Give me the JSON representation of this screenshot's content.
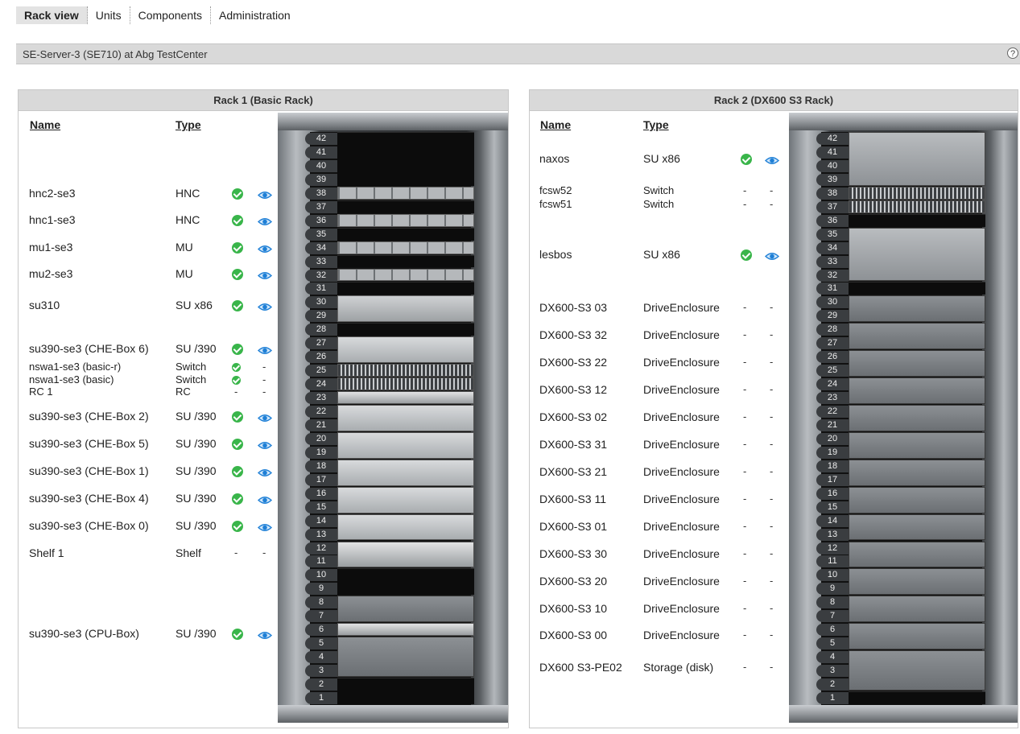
{
  "tabs": [
    {
      "label": "Rack view",
      "active": true
    },
    {
      "label": "Units",
      "active": false
    },
    {
      "label": "Components",
      "active": false
    },
    {
      "label": "Administration",
      "active": false
    }
  ],
  "header": {
    "title": "SE-Server-3 (SE710) at Abg TestCenter",
    "help": "?"
  },
  "columns": {
    "name": "Name",
    "type": "Type"
  },
  "rack1": {
    "title": "Rack 1 (Basic Rack)",
    "units": [
      "42",
      "41",
      "40",
      "39",
      "38",
      "37",
      "36",
      "35",
      "34",
      "33",
      "32",
      "31",
      "30",
      "29",
      "28",
      "27",
      "26",
      "25",
      "24",
      "23",
      "22",
      "21",
      "20",
      "19",
      "18",
      "17",
      "16",
      "15",
      "14",
      "13",
      "12",
      "11",
      "10",
      "9",
      "8",
      "7",
      "6",
      "5",
      "4",
      "3",
      "2",
      "1"
    ],
    "rows": [
      {
        "name": "hnc2-se3",
        "type": "HNC",
        "status": "ok",
        "view": true
      },
      {
        "name": "hnc1-se3",
        "type": "HNC",
        "status": "ok",
        "view": true
      },
      {
        "name": "mu1-se3",
        "type": "MU",
        "status": "ok",
        "view": true
      },
      {
        "name": "mu2-se3",
        "type": "MU",
        "status": "ok",
        "view": true
      },
      {
        "name": "su310",
        "type": "SU x86",
        "status": "ok",
        "view": true
      },
      {
        "name": "su390-se3 (CHE-Box 6)",
        "type": "SU /390",
        "status": "ok",
        "view": true
      },
      {
        "name": "nswa1-se3 (basic-r)",
        "type": "Switch",
        "status": "ok",
        "view": false,
        "dash": "-"
      },
      {
        "name": "nswa1-se3 (basic)",
        "type": "Switch",
        "status": "ok",
        "view": false,
        "dash": "-"
      },
      {
        "name": "RC 1",
        "type": "RC",
        "status": "-",
        "view": false,
        "dash": "-"
      },
      {
        "name": "su390-se3 (CHE-Box 2)",
        "type": "SU /390",
        "status": "ok",
        "view": true
      },
      {
        "name": "su390-se3 (CHE-Box 5)",
        "type": "SU /390",
        "status": "ok",
        "view": true
      },
      {
        "name": "su390-se3 (CHE-Box 1)",
        "type": "SU /390",
        "status": "ok",
        "view": true
      },
      {
        "name": "su390-se3 (CHE-Box 4)",
        "type": "SU /390",
        "status": "ok",
        "view": true
      },
      {
        "name": "su390-se3 (CHE-Box 0)",
        "type": "SU /390",
        "status": "ok",
        "view": true
      },
      {
        "name": "Shelf 1",
        "type": "Shelf",
        "status": "-",
        "view": false,
        "dash": "-"
      },
      {
        "name": "su390-se3 (CPU-Box)",
        "type": "SU /390",
        "status": "ok",
        "view": true
      }
    ]
  },
  "rack2": {
    "title": "Rack 2 (DX600 S3 Rack)",
    "units": [
      "42",
      "41",
      "40",
      "39",
      "38",
      "37",
      "36",
      "35",
      "34",
      "33",
      "32",
      "31",
      "30",
      "29",
      "28",
      "27",
      "26",
      "25",
      "24",
      "23",
      "22",
      "21",
      "20",
      "19",
      "18",
      "17",
      "16",
      "15",
      "14",
      "13",
      "12",
      "11",
      "10",
      "9",
      "8",
      "7",
      "6",
      "5",
      "4",
      "3",
      "2",
      "1"
    ],
    "rows": [
      {
        "name": "naxos",
        "type": "SU x86",
        "status": "ok",
        "view": true
      },
      {
        "name": "fcsw52",
        "type": "Switch",
        "status": "-",
        "view": false,
        "dash": "-"
      },
      {
        "name": "fcsw51",
        "type": "Switch",
        "status": "-",
        "view": false,
        "dash": "-"
      },
      {
        "name": "lesbos",
        "type": "SU x86",
        "status": "ok",
        "view": true
      },
      {
        "name": "DX600-S3 03",
        "type": "DriveEnclosure",
        "status": "-",
        "view": false,
        "dash": "-"
      },
      {
        "name": "DX600-S3 32",
        "type": "DriveEnclosure",
        "status": "-",
        "view": false,
        "dash": "-"
      },
      {
        "name": "DX600-S3 22",
        "type": "DriveEnclosure",
        "status": "-",
        "view": false,
        "dash": "-"
      },
      {
        "name": "DX600-S3 12",
        "type": "DriveEnclosure",
        "status": "-",
        "view": false,
        "dash": "-"
      },
      {
        "name": "DX600-S3 02",
        "type": "DriveEnclosure",
        "status": "-",
        "view": false,
        "dash": "-"
      },
      {
        "name": "DX600-S3 31",
        "type": "DriveEnclosure",
        "status": "-",
        "view": false,
        "dash": "-"
      },
      {
        "name": "DX600-S3 21",
        "type": "DriveEnclosure",
        "status": "-",
        "view": false,
        "dash": "-"
      },
      {
        "name": "DX600-S3 11",
        "type": "DriveEnclosure",
        "status": "-",
        "view": false,
        "dash": "-"
      },
      {
        "name": "DX600-S3 01",
        "type": "DriveEnclosure",
        "status": "-",
        "view": false,
        "dash": "-"
      },
      {
        "name": "DX600-S3 30",
        "type": "DriveEnclosure",
        "status": "-",
        "view": false,
        "dash": "-"
      },
      {
        "name": "DX600-S3 20",
        "type": "DriveEnclosure",
        "status": "-",
        "view": false,
        "dash": "-"
      },
      {
        "name": "DX600-S3 10",
        "type": "DriveEnclosure",
        "status": "-",
        "view": false,
        "dash": "-"
      },
      {
        "name": "DX600-S3 00",
        "type": "DriveEnclosure",
        "status": "-",
        "view": false,
        "dash": "-"
      },
      {
        "name": "DX600 S3-PE02",
        "type": "Storage (disk)",
        "status": "-",
        "view": false,
        "dash": "-"
      }
    ]
  },
  "colors": {
    "ok": "#39b54a",
    "eye": "#1e7fd6",
    "header_bg": "#d9d9d9"
  }
}
